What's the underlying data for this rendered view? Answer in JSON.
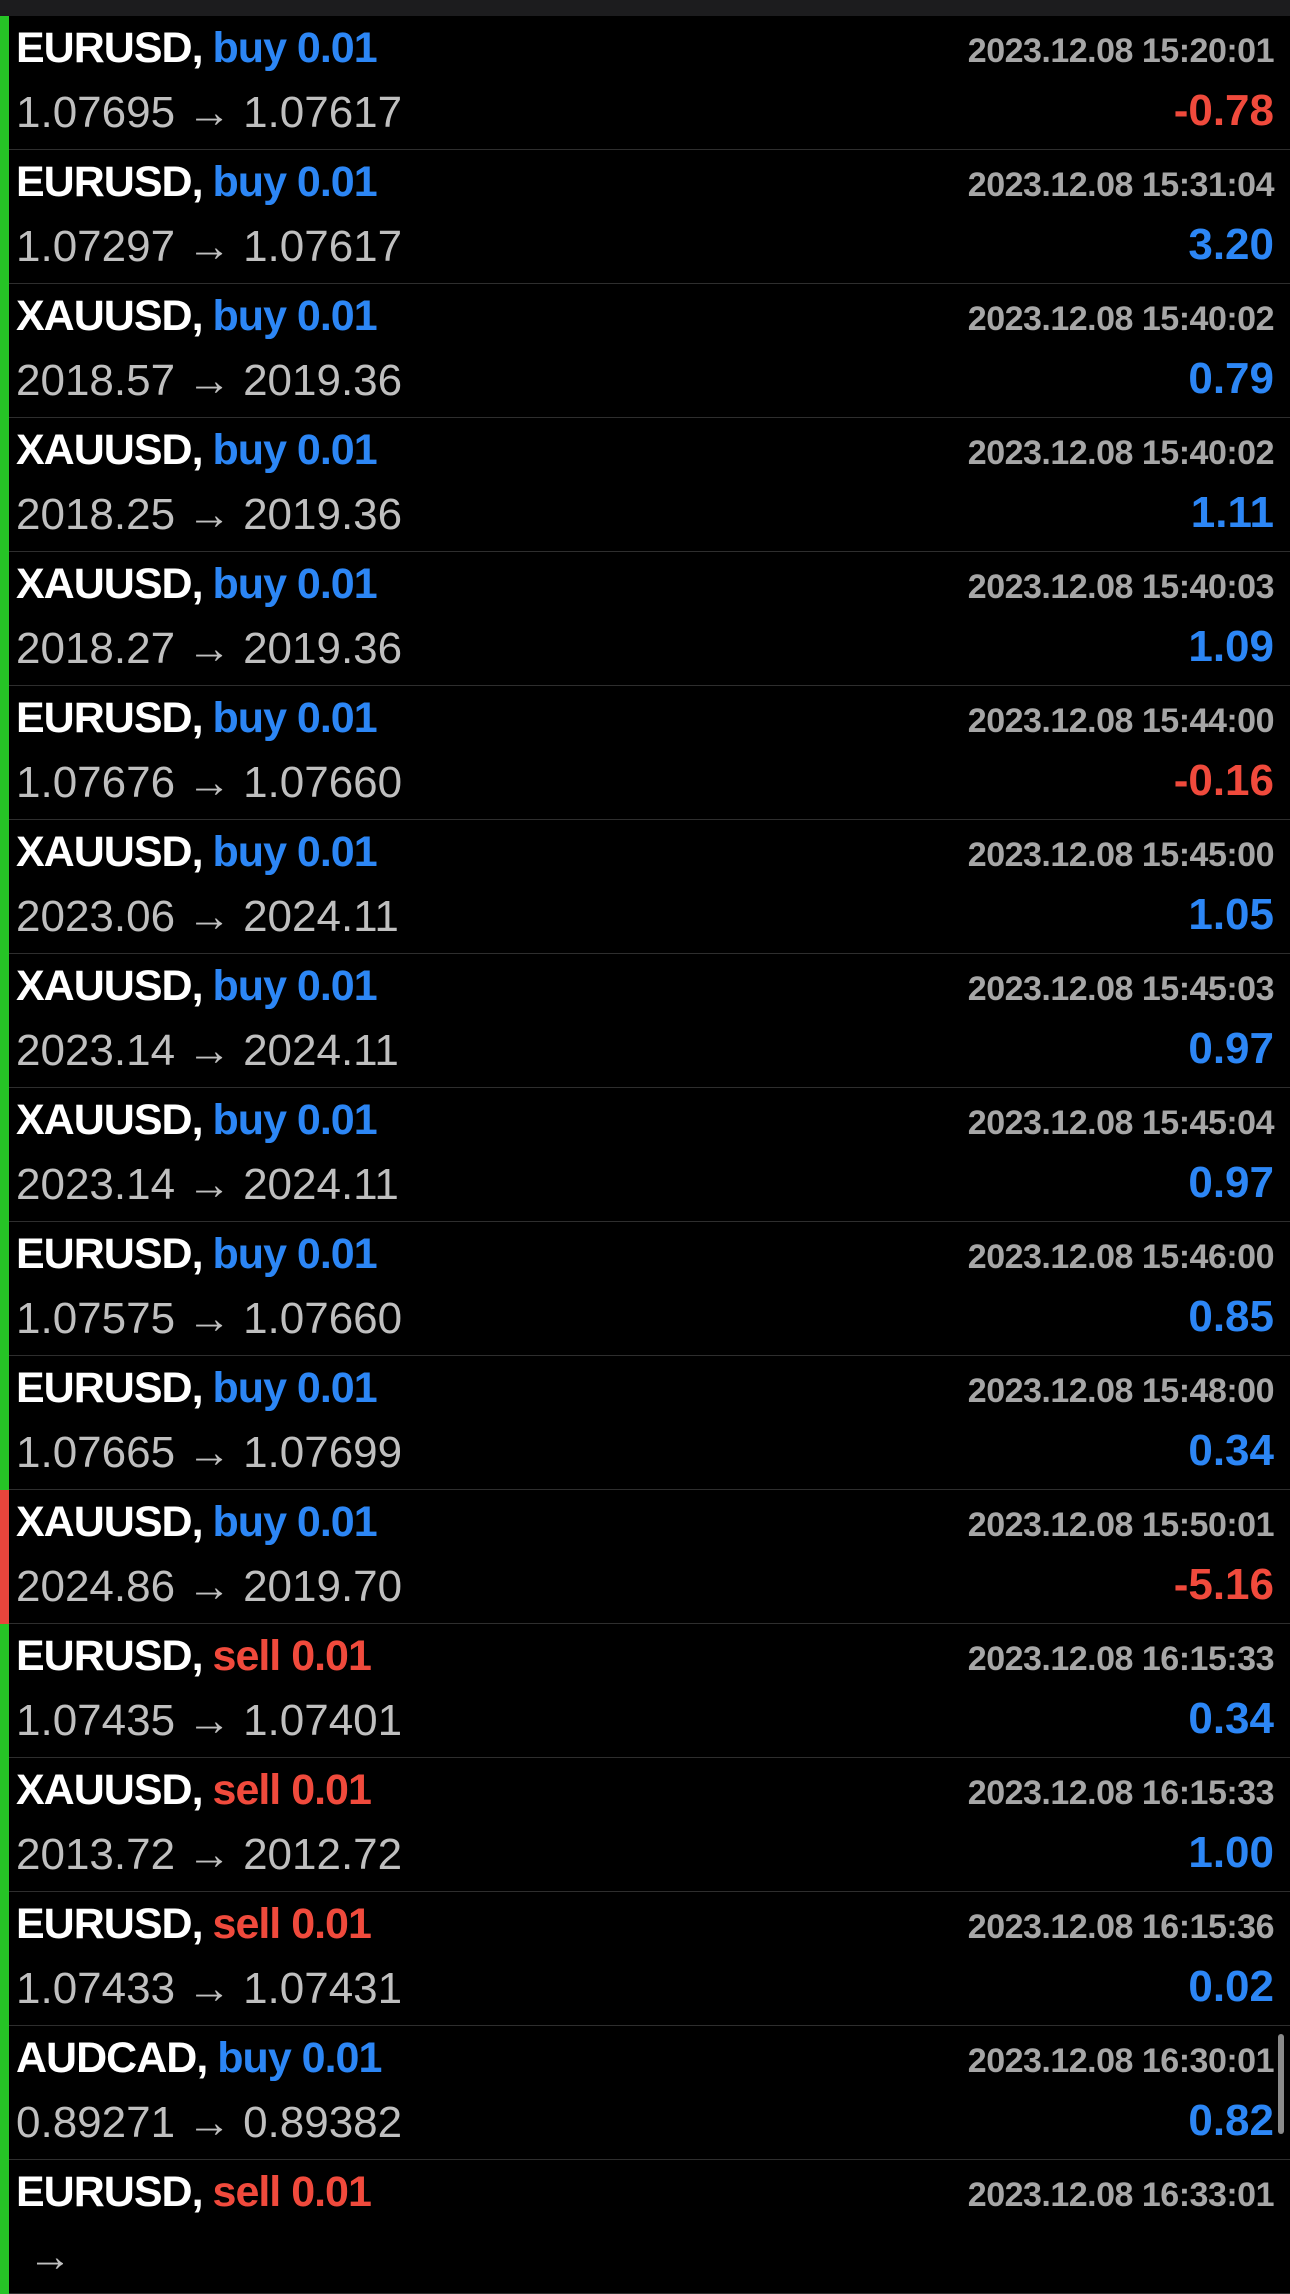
{
  "colors": {
    "buy": "#2c86f5",
    "sell": "#f04a3c",
    "profit_positive": "#2c86f5",
    "profit_negative": "#f04a3c",
    "bar_positive": "#26c426",
    "bar_negative": "#e8453c"
  },
  "arrow_glyph": "→",
  "trades": [
    {
      "symbol": "EURUSD",
      "side": "buy",
      "side_text": "buy 0.01",
      "time": "2023.12.08 15:20:01",
      "open_price": "1.07695",
      "close_price": "1.07617",
      "profit": "-0.78",
      "profit_sign": "negative",
      "bar": "positive"
    },
    {
      "symbol": "EURUSD",
      "side": "buy",
      "side_text": "buy 0.01",
      "time": "2023.12.08 15:31:04",
      "open_price": "1.07297",
      "close_price": "1.07617",
      "profit": "3.20",
      "profit_sign": "positive",
      "bar": "positive"
    },
    {
      "symbol": "XAUUSD",
      "side": "buy",
      "side_text": "buy 0.01",
      "time": "2023.12.08 15:40:02",
      "open_price": "2018.57",
      "close_price": "2019.36",
      "profit": "0.79",
      "profit_sign": "positive",
      "bar": "positive"
    },
    {
      "symbol": "XAUUSD",
      "side": "buy",
      "side_text": "buy 0.01",
      "time": "2023.12.08 15:40:02",
      "open_price": "2018.25",
      "close_price": "2019.36",
      "profit": "1.11",
      "profit_sign": "positive",
      "bar": "positive"
    },
    {
      "symbol": "XAUUSD",
      "side": "buy",
      "side_text": "buy 0.01",
      "time": "2023.12.08 15:40:03",
      "open_price": "2018.27",
      "close_price": "2019.36",
      "profit": "1.09",
      "profit_sign": "positive",
      "bar": "positive"
    },
    {
      "symbol": "EURUSD",
      "side": "buy",
      "side_text": "buy 0.01",
      "time": "2023.12.08 15:44:00",
      "open_price": "1.07676",
      "close_price": "1.07660",
      "profit": "-0.16",
      "profit_sign": "negative",
      "bar": "positive"
    },
    {
      "symbol": "XAUUSD",
      "side": "buy",
      "side_text": "buy 0.01",
      "time": "2023.12.08 15:45:00",
      "open_price": "2023.06",
      "close_price": "2024.11",
      "profit": "1.05",
      "profit_sign": "positive",
      "bar": "positive"
    },
    {
      "symbol": "XAUUSD",
      "side": "buy",
      "side_text": "buy 0.01",
      "time": "2023.12.08 15:45:03",
      "open_price": "2023.14",
      "close_price": "2024.11",
      "profit": "0.97",
      "profit_sign": "positive",
      "bar": "positive"
    },
    {
      "symbol": "XAUUSD",
      "side": "buy",
      "side_text": "buy 0.01",
      "time": "2023.12.08 15:45:04",
      "open_price": "2023.14",
      "close_price": "2024.11",
      "profit": "0.97",
      "profit_sign": "positive",
      "bar": "positive"
    },
    {
      "symbol": "EURUSD",
      "side": "buy",
      "side_text": "buy 0.01",
      "time": "2023.12.08 15:46:00",
      "open_price": "1.07575",
      "close_price": "1.07660",
      "profit": "0.85",
      "profit_sign": "positive",
      "bar": "positive"
    },
    {
      "symbol": "EURUSD",
      "side": "buy",
      "side_text": "buy 0.01",
      "time": "2023.12.08 15:48:00",
      "open_price": "1.07665",
      "close_price": "1.07699",
      "profit": "0.34",
      "profit_sign": "positive",
      "bar": "positive"
    },
    {
      "symbol": "XAUUSD",
      "side": "buy",
      "side_text": "buy 0.01",
      "time": "2023.12.08 15:50:01",
      "open_price": "2024.86",
      "close_price": "2019.70",
      "profit": "-5.16",
      "profit_sign": "negative",
      "bar": "negative"
    },
    {
      "symbol": "EURUSD",
      "side": "sell",
      "side_text": "sell 0.01",
      "time": "2023.12.08 16:15:33",
      "open_price": "1.07435",
      "close_price": "1.07401",
      "profit": "0.34",
      "profit_sign": "positive",
      "bar": "positive"
    },
    {
      "symbol": "XAUUSD",
      "side": "sell",
      "side_text": "sell 0.01",
      "time": "2023.12.08 16:15:33",
      "open_price": "2013.72",
      "close_price": "2012.72",
      "profit": "1.00",
      "profit_sign": "positive",
      "bar": "positive"
    },
    {
      "symbol": "EURUSD",
      "side": "sell",
      "side_text": "sell 0.01",
      "time": "2023.12.08 16:15:36",
      "open_price": "1.07433",
      "close_price": "1.07431",
      "profit": "0.02",
      "profit_sign": "positive",
      "bar": "positive"
    },
    {
      "symbol": "AUDCAD",
      "side": "buy",
      "side_text": "buy 0.01",
      "time": "2023.12.08 16:30:01",
      "open_price": "0.89271",
      "close_price": "0.89382",
      "profit": "0.82",
      "profit_sign": "positive",
      "bar": "positive"
    },
    {
      "symbol": "EURUSD",
      "side": "sell",
      "side_text": "sell 0.01",
      "time": "2023.12.08 16:33:01",
      "open_price": "",
      "close_price": "",
      "profit": "",
      "profit_sign": "positive",
      "bar": "positive"
    }
  ]
}
